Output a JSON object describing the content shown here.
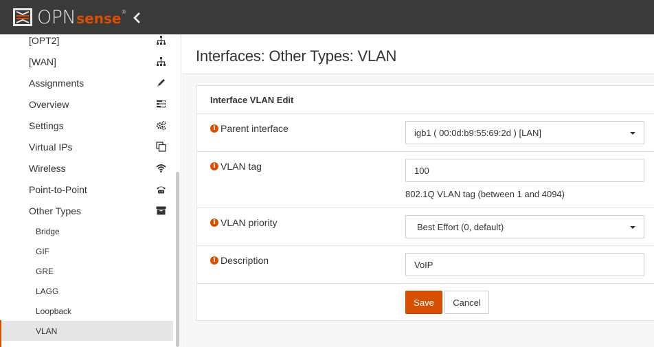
{
  "brand": {
    "logo_primary": "OPN",
    "logo_secondary": "sense",
    "logo_mark": "®",
    "accent": "#d94f00"
  },
  "topbar": {
    "collapse_icon": "chevron-left-icon"
  },
  "sidebar": {
    "items": [
      {
        "label": "[OPT2]",
        "icon": "sitemap-icon"
      },
      {
        "label": "[WAN]",
        "icon": "sitemap-icon"
      },
      {
        "label": "Assignments",
        "icon": "pencil-icon"
      },
      {
        "label": "Overview",
        "icon": "tasks-icon"
      },
      {
        "label": "Settings",
        "icon": "cogs-icon"
      },
      {
        "label": "Virtual IPs",
        "icon": "clone-icon"
      },
      {
        "label": "Wireless",
        "icon": "wifi-icon"
      },
      {
        "label": "Point-to-Point",
        "icon": "phone-icon"
      },
      {
        "label": "Other Types",
        "icon": "archive-icon"
      }
    ],
    "subitems": [
      {
        "label": "Bridge"
      },
      {
        "label": "GIF"
      },
      {
        "label": "GRE"
      },
      {
        "label": "LAGG"
      },
      {
        "label": "Loopback"
      },
      {
        "label": "VLAN",
        "active": true
      }
    ]
  },
  "page": {
    "title": "Interfaces: Other Types: VLAN"
  },
  "form": {
    "heading": "Interface VLAN Edit",
    "parent_interface": {
      "label": "Parent interface",
      "value": "igb1 ( 00:0d:b9:55:69:2d ) [LAN]"
    },
    "vlan_tag": {
      "label": "VLAN tag",
      "value": "100",
      "help": "802.1Q VLAN tag (between 1 and 4094)"
    },
    "vlan_priority": {
      "label": "VLAN priority",
      "value": "Best Effort (0, default)"
    },
    "description": {
      "label": "Description",
      "value": "VoIP"
    },
    "save_label": "Save",
    "cancel_label": "Cancel"
  }
}
